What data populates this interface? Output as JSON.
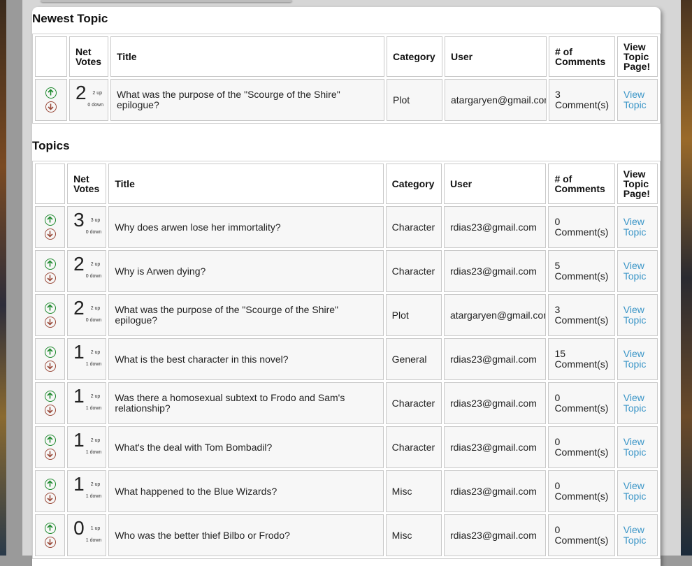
{
  "newest": {
    "title": "Newest Topic",
    "headers": {
      "net": "Net Votes",
      "title": "Title",
      "category": "Category",
      "user": "User",
      "comments": "# of Comments",
      "view": "View Topic Page!"
    },
    "rows": [
      {
        "net": "2",
        "up": "2 up",
        "down": "0 down",
        "title": "What was the purpose of the \"Scourge of the Shire\" epilogue?",
        "category": "Plot",
        "user": "atargaryen@gmail.com",
        "comments": "3 Comment(s)",
        "link": "View Topic"
      }
    ]
  },
  "topics": {
    "title": "Topics",
    "headers": {
      "net": "Net Votes",
      "title": "Title",
      "category": "Category",
      "user": "User",
      "comments": "# of Comments",
      "view": "View Topic Page!"
    },
    "rows": [
      {
        "net": "3",
        "up": "3 up",
        "down": "0 down",
        "title": "Why does arwen lose her immortality?",
        "category": "Character",
        "user": "rdias23@gmail.com",
        "comments": "0 Comment(s)",
        "link": "View Topic"
      },
      {
        "net": "2",
        "up": "2 up",
        "down": "0 down",
        "title": "Why is Arwen dying?",
        "category": "Character",
        "user": "rdias23@gmail.com",
        "comments": "5 Comment(s)",
        "link": "View Topic"
      },
      {
        "net": "2",
        "up": "2 up",
        "down": "0 down",
        "title": "What was the purpose of the \"Scourge of the Shire\" epilogue?",
        "category": "Plot",
        "user": "atargaryen@gmail.com",
        "comments": "3 Comment(s)",
        "link": "View Topic"
      },
      {
        "net": "1",
        "up": "2 up",
        "down": "1 down",
        "title": "What is the best character in this novel?",
        "category": "General",
        "user": "rdias23@gmail.com",
        "comments": "15 Comment(s)",
        "link": "View Topic"
      },
      {
        "net": "1",
        "up": "2 up",
        "down": "1 down",
        "title": "Was there a homosexual subtext to Frodo and Sam's relationship?",
        "category": "Character",
        "user": "rdias23@gmail.com",
        "comments": "0 Comment(s)",
        "link": "View Topic"
      },
      {
        "net": "1",
        "up": "2 up",
        "down": "1 down",
        "title": "What's the deal with Tom Bombadil?",
        "category": "Character",
        "user": "rdias23@gmail.com",
        "comments": "0 Comment(s)",
        "link": "View Topic"
      },
      {
        "net": "1",
        "up": "2 up",
        "down": "1 down",
        "title": "What happened to the Blue Wizards?",
        "category": "Misc",
        "user": "rdias23@gmail.com",
        "comments": "0 Comment(s)",
        "link": "View Topic"
      },
      {
        "net": "0",
        "up": "1 up",
        "down": "1 down",
        "title": "Who was the better thief Bilbo or Frodo?",
        "category": "Misc",
        "user": "rdias23@gmail.com",
        "comments": "0 Comment(s)",
        "link": "View Topic"
      }
    ]
  },
  "colors": {
    "link": "#3a95c7",
    "upvote": "#1e8a2e",
    "downvote": "#9a4a3a"
  },
  "icons": {
    "up": "arrow-up-circle-icon",
    "down": "arrow-down-circle-icon"
  }
}
